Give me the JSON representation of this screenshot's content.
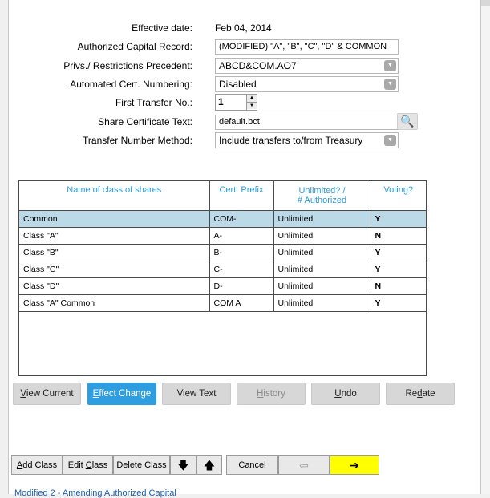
{
  "form": {
    "effective_date_label": "Effective date:",
    "effective_date_value": "Feb 04, 2014",
    "authorized_capital_label": "Authorized Capital Record:",
    "authorized_capital_value": "(MODIFIED) \"A\", \"B\", \"C\", \"D\" & COMMON",
    "privs_label": "Privs./ Restrictions Precedent:",
    "privs_value": "ABCD&COM.AO7",
    "cert_numbering_label": "Automated Cert. Numbering:",
    "cert_numbering_value": "Disabled",
    "first_transfer_label": "First Transfer No.:",
    "first_transfer_value": "1",
    "share_cert_text_label": "Share Certificate Text:",
    "share_cert_text_value": "default.bct",
    "transfer_method_label": "Transfer Number Method:",
    "transfer_method_value": "Include transfers to/from Treasury"
  },
  "grid": {
    "headers": {
      "name": "Name of class of shares",
      "prefix": "Cert. Prefix",
      "unlimited_line1": "Unlimited? /",
      "unlimited_line2": "# Authorized",
      "voting": "Voting?"
    },
    "rows": [
      {
        "name": "Common",
        "prefix": "COM-",
        "authorized": "Unlimited",
        "voting": "Y"
      },
      {
        "name": "Class \"A\"",
        "prefix": "A-",
        "authorized": "Unlimited",
        "voting": "N"
      },
      {
        "name": "Class \"B\"",
        "prefix": "B-",
        "authorized": "Unlimited",
        "voting": "Y"
      },
      {
        "name": "Class \"C\"",
        "prefix": "C-",
        "authorized": "Unlimited",
        "voting": "Y"
      },
      {
        "name": "Class \"D\"",
        "prefix": "D-",
        "authorized": "Unlimited",
        "voting": "N"
      },
      {
        "name": "Class \"A\" Common",
        "prefix": "COM A",
        "authorized": "Unlimited",
        "voting": "Y"
      }
    ]
  },
  "actions": {
    "view_current_mn": "V",
    "view_current_rest": "iew Current",
    "effect_change_mn": "E",
    "effect_change_rest": "ffect Change",
    "view_text": "View Text",
    "history_mn": "H",
    "history_rest": "istory",
    "undo_mn": "U",
    "undo_rest": "ndo",
    "redate_pre": "Re",
    "redate_mn": "d",
    "redate_post": "ate"
  },
  "toolbar": {
    "add_class_mn": "A",
    "add_class_rest": "dd Class",
    "edit_class_pre": "Edit ",
    "edit_class_mn": "C",
    "edit_class_post": "lass",
    "delete_class": "Delete Class",
    "move_down_glyph": "🡇",
    "move_up_glyph": "🡅",
    "cancel": "Cancel",
    "back_glyph": "⇦",
    "next_glyph": "➔"
  },
  "status": {
    "cutoff_text": "Modified 2 - Amending Authorized Capital"
  },
  "icons": {
    "combo_arrow": "▼",
    "spin_up": "▲",
    "spin_down": "▼",
    "search": "🔍"
  }
}
